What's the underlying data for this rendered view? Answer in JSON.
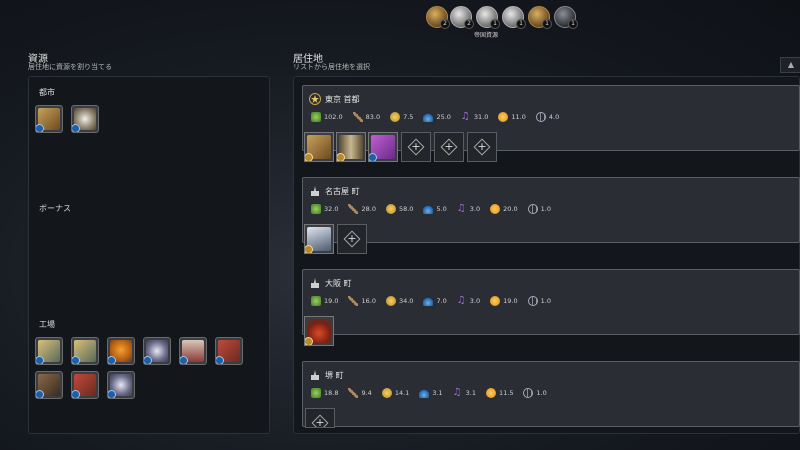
{
  "top_bar": {
    "label": "帝国資源",
    "resources": [
      {
        "name": "gold-resource-icon",
        "style": "gold"
      },
      {
        "name": "silver-resource-icon",
        "style": "silver"
      },
      {
        "name": "silver-resource-icon",
        "style": "silver"
      },
      {
        "name": "silver-resource-icon",
        "style": "silver"
      },
      {
        "name": "gold-resource-icon",
        "style": "gold"
      },
      {
        "name": "dark-resource-icon",
        "style": "dark"
      }
    ]
  },
  "resources_panel": {
    "title": "資源",
    "subtitle": "居住地に資源を割り当てる",
    "categories": {
      "city": "都市",
      "bonus": "ボーナス",
      "factory": "工場"
    }
  },
  "settlements_panel": {
    "title": "居住地",
    "subtitle": "リストから居住地を選択",
    "scroll_label": "▲"
  },
  "settlements": [
    {
      "name": "東京 首都",
      "icon": "capital-star-icon",
      "yields": {
        "food": "102.0",
        "production": "83.0",
        "gold": "7.5",
        "science": "25.0",
        "culture": "31.0",
        "happiness": "11.0",
        "influence": "4.0"
      }
    },
    {
      "name": "名古屋 町",
      "icon": "town-icon",
      "yields": {
        "food": "32.0",
        "production": "28.0",
        "gold": "58.0",
        "science": "5.0",
        "culture": "3.0",
        "happiness": "20.0",
        "influence": "1.0"
      }
    },
    {
      "name": "大阪 町",
      "icon": "town-icon",
      "yields": {
        "food": "19.0",
        "production": "16.0",
        "gold": "34.0",
        "science": "7.0",
        "culture": "3.0",
        "happiness": "19.0",
        "influence": "1.0"
      }
    },
    {
      "name": "堺 町",
      "icon": "town-icon",
      "yields": {
        "food": "18.8",
        "production": "9.4",
        "gold": "14.1",
        "science": "3.1",
        "culture": "3.1",
        "happiness": "11.5",
        "influence": "1.0"
      }
    }
  ],
  "colors": {
    "accent_gold": "#b88a2a",
    "accent_blue": "#1e5fa8",
    "panel_bg": "#13161b",
    "card_bg": "#2a2d33"
  }
}
